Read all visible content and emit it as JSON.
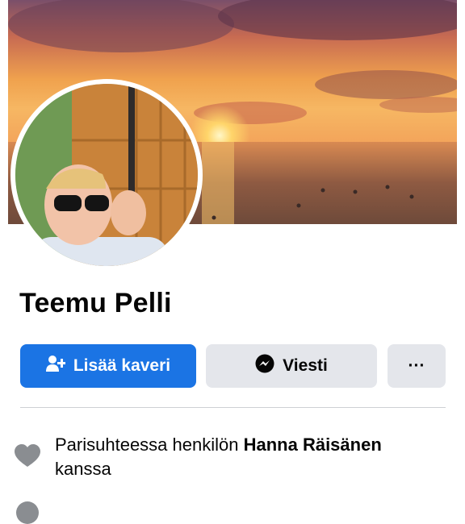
{
  "profile": {
    "name": "Teemu Pelli"
  },
  "actions": {
    "add_friend_label": "Lisää kaveri",
    "message_label": "Viesti",
    "more_label": "···"
  },
  "relationship": {
    "prefix": "Parisuhteessa henkilön ",
    "partner": "Hanna Räisänen",
    "suffix": " kanssa"
  },
  "icons": {
    "add_friend": "add-friend-icon",
    "messenger": "messenger-icon",
    "more": "more-icon",
    "relationship": "heart-icon"
  },
  "colors": {
    "accent": "#1b74e4",
    "secondary_button": "#e4e6eb",
    "icon_gray": "#8a8d91"
  }
}
